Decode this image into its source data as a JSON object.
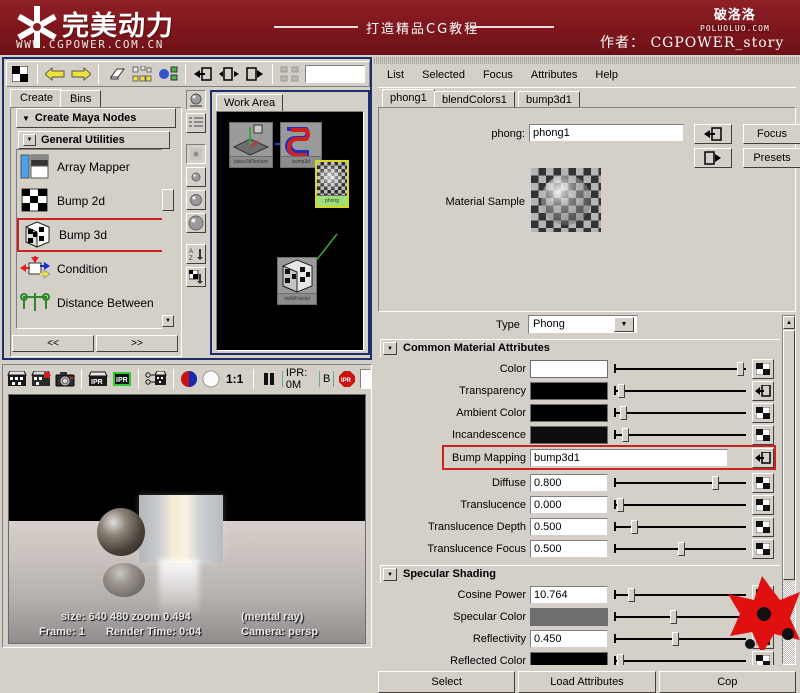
{
  "banner": {
    "site_name_cn": "完美动力",
    "site_url": "WWW.CGPOWER.COM.CN",
    "tagline": "打造精品CG教程",
    "author_label": "作者：",
    "author_name": "CGPOWER_story",
    "watermark_top": "破洛洛",
    "watermark_bottom": "POLUOLUO.COM"
  },
  "hypershade": {
    "toolbar_icons": [
      "checker-swatch-icon",
      "back-arrow-icon",
      "forward-arrow-icon",
      "eraser-icon",
      "graph-nodes-icon",
      "network-icon",
      "input-connections-icon",
      "input-output-connections-icon",
      "output-connections-icon",
      "rearrange-graph-icon"
    ],
    "search_value": "",
    "tabs": [
      {
        "label": "Create",
        "selected": true
      },
      {
        "label": "Bins",
        "selected": false
      }
    ],
    "create_bar_label": "Create Maya Nodes",
    "section_label": "General Utilities",
    "nodes": [
      {
        "label": "Array Mapper",
        "icon": "array-mapper-icon",
        "highlighted": false
      },
      {
        "label": "Bump 2d",
        "icon": "bump2d-icon",
        "highlighted": false
      },
      {
        "label": "Bump 3d",
        "icon": "bump3d-icon",
        "highlighted": true
      },
      {
        "label": "Condition",
        "icon": "condition-icon",
        "highlighted": false
      },
      {
        "label": "Distance Between",
        "icon": "distance-between-icon",
        "highlighted": false
      }
    ],
    "nav_prev": "<<",
    "nav_next": ">>",
    "swatch_buttons": [
      "render-swatch-icon",
      "list-view-icon",
      "swatch-xs-icon",
      "swatch-s-icon",
      "swatch-m-icon",
      "swatch-l-icon",
      "sort-az-icon",
      "sort-type-icon"
    ],
    "work_area": {
      "tab_label": "Work Area",
      "nodes": [
        {
          "name": "place3dTexture",
          "selected": false
        },
        {
          "name": "bump3d",
          "selected": false
        },
        {
          "name": "phong",
          "selected": true
        },
        {
          "name": "solidFractal",
          "selected": false
        }
      ]
    }
  },
  "render_view": {
    "toolbar_icons": [
      "render-icon",
      "render-region-icon",
      "snapshot-icon",
      "ipr-render-icon",
      "ipr-stop-icon",
      "render-settings-icon",
      "rgb-channel-icon",
      "alpha-channel-icon"
    ],
    "zoom_ratio": "1:1",
    "pause_icon": "pause-icon",
    "ipr_label": "IPR: 0M",
    "byte_label": "B",
    "ipr_stop_icon": "ipr-stop-badge-icon",
    "status": {
      "size_label": "size:",
      "size_w": "640",
      "size_h": "480",
      "zoom_label": "zoom",
      "zoom_value": "0.494",
      "renderer": "(mental ray)",
      "frame_label": "Frame:",
      "frame_value": "1",
      "render_time_label": "Render Time:",
      "render_time_value": "0:04",
      "camera_label": "Camera:",
      "camera_value": "persp"
    }
  },
  "attribute_editor": {
    "menus": [
      "List",
      "Selected",
      "Focus",
      "Attributes",
      "Help"
    ],
    "tabs": [
      {
        "label": "phong1",
        "selected": true
      },
      {
        "label": "blendColors1",
        "selected": false
      },
      {
        "label": "bump3d1",
        "selected": false
      }
    ],
    "node_type_label": "phong:",
    "node_name": "phong1",
    "focus_button": "Focus",
    "presets_button": "Presets",
    "input_conn_icon": "input-connection-icon",
    "output_conn_icon": "output-connection-icon",
    "material_sample_label": "Material Sample",
    "type_label": "Type",
    "type_value": "Phong",
    "sections": [
      {
        "title": "Common Material Attributes",
        "rows": [
          {
            "label": "Color",
            "kind": "color",
            "color": "#ffffff",
            "slider": 0.96,
            "map": "checker-map-icon"
          },
          {
            "label": "Transparency",
            "kind": "color",
            "color": "#000000",
            "slider": 0.03,
            "map": "input-connection-icon"
          },
          {
            "label": "Ambient Color",
            "kind": "color",
            "color": "#000000",
            "slider": 0.05,
            "map": "checker-map-icon"
          },
          {
            "label": "Incandescence",
            "kind": "color",
            "color": "#0d0d0d",
            "slider": 0.06,
            "map": "checker-map-icon"
          },
          {
            "label": "Bump Mapping",
            "kind": "text-wide",
            "value": "bump3d1",
            "highlighted": true,
            "map": "input-connection-icon"
          },
          {
            "label": "Diffuse",
            "kind": "text",
            "value": "0.800",
            "slider": 0.76,
            "map": "checker-map-icon"
          },
          {
            "label": "Translucence",
            "kind": "text",
            "value": "0.000",
            "slider": 0.02,
            "map": "checker-map-icon"
          },
          {
            "label": "Translucence Depth",
            "kind": "text",
            "value": "0.500",
            "slider": 0.13,
            "map": "checker-map-icon"
          },
          {
            "label": "Translucence Focus",
            "kind": "text",
            "value": "0.500",
            "slider": 0.5,
            "map": "checker-map-icon"
          }
        ]
      },
      {
        "title": "Specular Shading",
        "rows": [
          {
            "label": "Cosine Power",
            "kind": "text",
            "value": "10.764",
            "slider": 0.11,
            "map": "checker-map-icon"
          },
          {
            "label": "Specular Color",
            "kind": "color",
            "color": "#6e6e6e",
            "slider": 0.44,
            "map": "checker-map-icon"
          },
          {
            "label": "Reflectivity",
            "kind": "text",
            "value": "0.450",
            "slider": 0.45,
            "map": "checker-map-icon"
          },
          {
            "label": "Reflected Color",
            "kind": "color",
            "color": "#000000",
            "slider": 0.02,
            "map": "checker-map-icon"
          }
        ]
      }
    ],
    "buttons": [
      "Select",
      "Load Attributes",
      "Cop"
    ]
  },
  "colors": {
    "banner_red": "#8c1c23",
    "chrome": "#d4d0c8",
    "highlight_red": "#cc2222",
    "node_border_blue": "#1d2f6b"
  }
}
